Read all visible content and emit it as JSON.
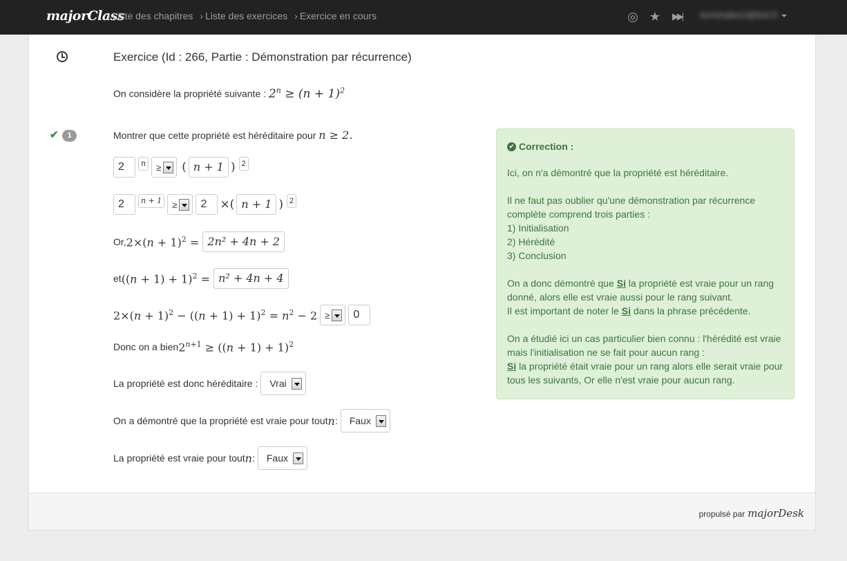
{
  "brand": "majorClass",
  "breadcrumbs": [
    {
      "label": "Liste des chapitres"
    },
    {
      "label": "Liste des exercices"
    },
    {
      "label": "Exercice en cours"
    }
  ],
  "nav_icons": [
    "target-icon",
    "star-icon",
    "skip-forward-icon"
  ],
  "user": {
    "email": "terminales1@test.fr"
  },
  "exercise": {
    "title": "Exercice (Id : 266, Partie : Démonstration par récurrence)",
    "statement_label": "On considère la propriété suivante : ",
    "question_number": "1",
    "question_text": "Montrer que cette propriété est héréditaire pour ",
    "question_cond": "n ≥ 2.",
    "row1": {
      "base": "2",
      "exp": "n",
      "op": "≥",
      "inner": "n + 1",
      "power": "2"
    },
    "row2": {
      "base": "2",
      "exp": "n + 1",
      "op": "≥",
      "factor": "2",
      "inner": "n + 1",
      "power": "2"
    },
    "row3": {
      "prefix": "Or, ",
      "answer": "2n² + 4n + 2"
    },
    "row4": {
      "prefix": "et ",
      "answer": "n² + 4n + 4"
    },
    "row5": {
      "op": "≥",
      "value": "0"
    },
    "row6": {
      "text": "Donc on a bien "
    },
    "row7": {
      "text": "La propriété est donc héréditaire : ",
      "value": "Vrai"
    },
    "row8": {
      "text": "On a démontré que la propriété est vraie pour tout ",
      "var": "n",
      "suffix": " :",
      "value": "Faux"
    },
    "row9": {
      "text": "La propriété est vraie pour tout ",
      "var": "n",
      "suffix": " :",
      "value": "Faux"
    }
  },
  "correction": {
    "title": "Correction :",
    "p1": "Ici, on n'a démontré que la propriété est héréditaire.",
    "p2": "Il ne faut pas oublier qu'une démonstration par récurrence complète comprend trois parties :",
    "parts": [
      "1) Initialisation",
      "2) Hérédité",
      "3) Conclusion"
    ],
    "p3_a": "On a donc démontré que ",
    "p3_si": "Si",
    "p3_b": " la propriété est vraie pour un rang donné, alors elle est vraie aussi pour le rang suivant.",
    "p3_c": "Il est important de noter le ",
    "p3_si2": "Si",
    "p3_d": " dans la phrase précédente.",
    "p4_a": "On a étudié ici un cas particulier bien connu : l'hérédité est vraie mais l'initialisation ne se fait pour aucun rang :",
    "p4_si": "Si",
    "p4_b": " la propriété était vraie pour un rang alors elle serait vraie pour tous les suivants, Or elle n'est vraie pour aucun rang."
  },
  "footer": {
    "powered": "propulsé par",
    "brand": "majorDesk"
  }
}
